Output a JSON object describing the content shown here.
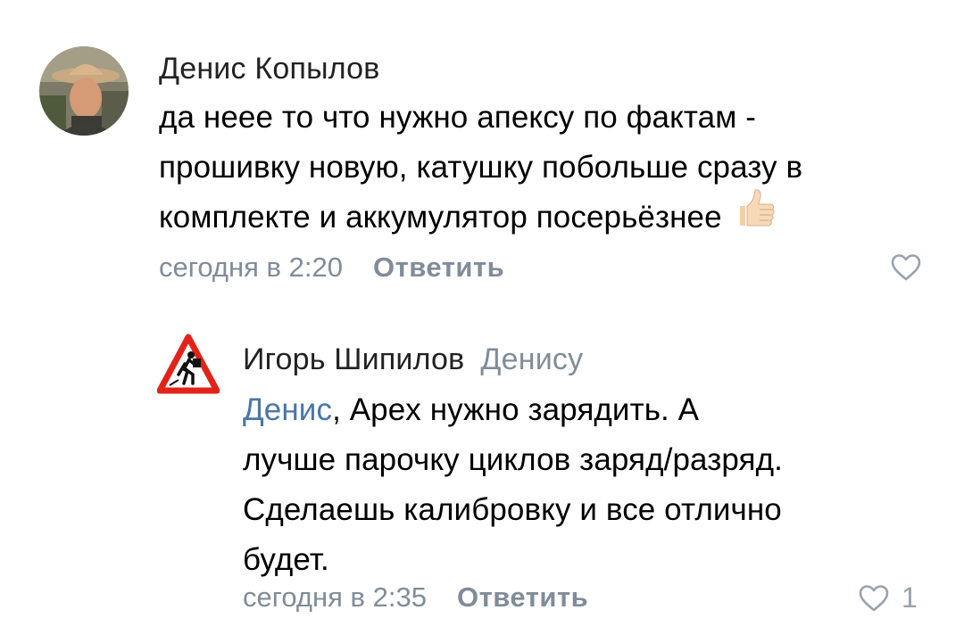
{
  "comments": [
    {
      "author": "Денис Копылов",
      "lines": [
        "да неее то что нужно апексу по фактам -",
        "прошивку новую, катушку побольше сразу в",
        "комплекте и аккумулятор посерьёзнее"
      ],
      "emoji_icon": "thumbs-up-icon",
      "time": "сегодня в 2:20",
      "reply_label": "Ответить",
      "likes": ""
    },
    {
      "author": "Игорь Шипилов",
      "reply_to": "Денису",
      "mention": "Денис",
      "lines": [
        ", Apex нужно зарядить. А",
        "лучше парочку циклов заряд/разряд.",
        "Сделаешь калибровку и все отлично",
        "будет."
      ],
      "time": "сегодня в 2:35",
      "reply_label": "Ответить",
      "likes": "1"
    }
  ],
  "colors": {
    "mention": "#4a76a8",
    "meta": "#818c99",
    "author": "#222222",
    "like_icon": "#99a2ad"
  }
}
